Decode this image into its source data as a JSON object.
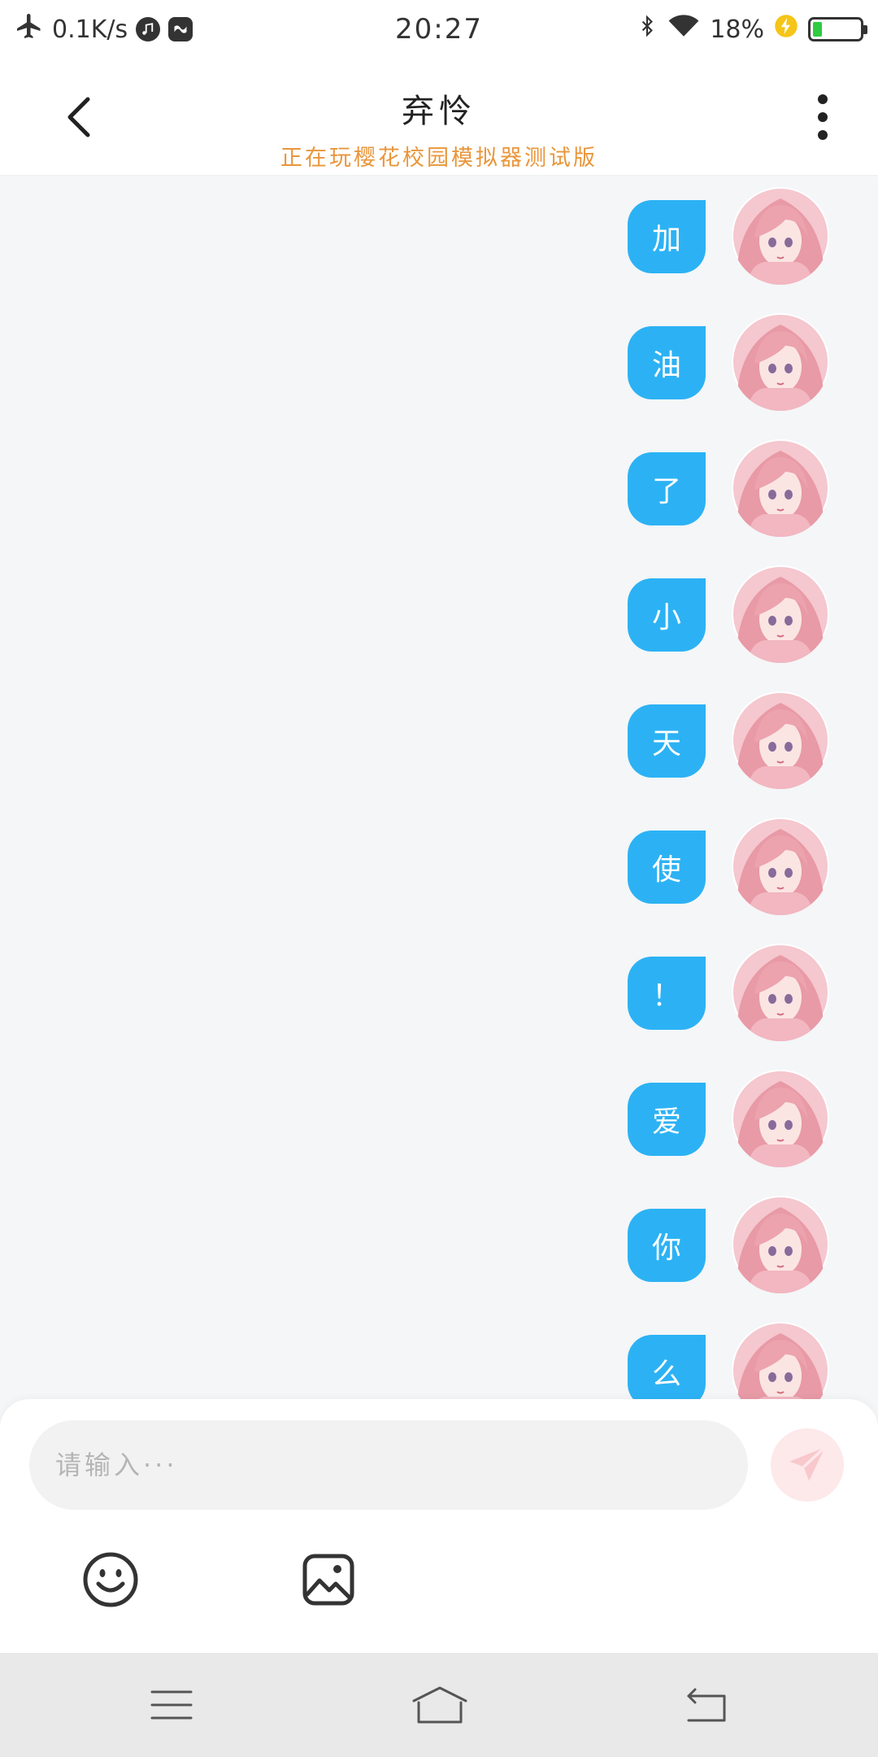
{
  "status_bar": {
    "net_speed": "0.1K/s",
    "time": "20:27",
    "battery_percent": "18%",
    "battery_level": 0.18,
    "battery_color": "#2ecc40",
    "icons": [
      "airplane-icon",
      "music-notification-icon",
      "app-notification-icon",
      "bluetooth-icon",
      "wifi-icon",
      "charging-icon",
      "battery-icon"
    ]
  },
  "header": {
    "title": "弃怜",
    "subtitle": "正在玩樱花校园模拟器测试版",
    "subtitle_color": "#e9963b",
    "back_icon": "chevron-left-icon",
    "more_icon": "more-vertical-icon"
  },
  "chat": {
    "bubble_color": "#2cb2f4",
    "messages": [
      {
        "text": "加",
        "sender": "self"
      },
      {
        "text": "油",
        "sender": "self"
      },
      {
        "text": "了",
        "sender": "self"
      },
      {
        "text": "小",
        "sender": "self"
      },
      {
        "text": "天",
        "sender": "self"
      },
      {
        "text": "使",
        "sender": "self"
      },
      {
        "text": "！",
        "sender": "self"
      },
      {
        "text": "爱",
        "sender": "self"
      },
      {
        "text": "你",
        "sender": "self"
      },
      {
        "text": "么",
        "sender": "self"
      }
    ]
  },
  "input": {
    "placeholder": "请输入···",
    "value": "",
    "send_icon": "send-icon",
    "emoji_icon": "emoji-icon",
    "image_icon": "image-icon"
  },
  "nav_bar": {
    "icons": [
      "menu-icon",
      "home-icon",
      "back-icon"
    ]
  }
}
